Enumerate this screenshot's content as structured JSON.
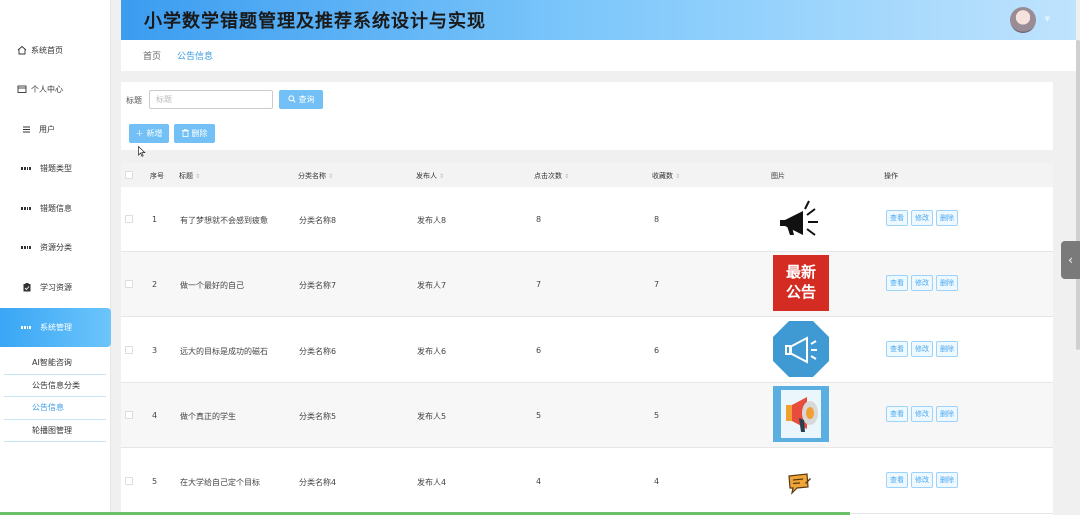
{
  "app": {
    "title": "小学数学错题管理及推荐系统设计与实现"
  },
  "sidebar": {
    "items": [
      {
        "label": "系统首页",
        "icon": "home-icon"
      },
      {
        "label": "个人中心",
        "icon": "card-icon"
      },
      {
        "label": "用户",
        "icon": "list-icon"
      },
      {
        "label": "错题类型",
        "icon": "grid-icon"
      },
      {
        "label": "错题信息",
        "icon": "grid-icon"
      },
      {
        "label": "资源分类",
        "icon": "grid-icon"
      },
      {
        "label": "学习资源",
        "icon": "clipboard-icon"
      },
      {
        "label": "系统管理",
        "icon": "grid-icon",
        "active": true
      }
    ],
    "submenu": [
      {
        "label": "AI智能咨询"
      },
      {
        "label": "公告信息分类"
      },
      {
        "label": "公告信息",
        "active": true
      },
      {
        "label": "轮播图管理"
      }
    ]
  },
  "breadcrumb": {
    "home": "首页",
    "current": "公告信息"
  },
  "search": {
    "label": "标题",
    "placeholder": "标题",
    "button": "查询"
  },
  "toolbar": {
    "add": "新增",
    "delete": "删除"
  },
  "table": {
    "columns": [
      "序号",
      "标题",
      "分类名称",
      "发布人",
      "点击次数",
      "收藏数",
      "图片",
      "操作"
    ],
    "rows": [
      {
        "index": "1",
        "title": "有了梦想就不会感到疲惫",
        "category": "分类名称8",
        "publisher": "发布人8",
        "clicks": "8",
        "favorites": "8",
        "image": "megaphone-icon"
      },
      {
        "index": "2",
        "title": "做一个最好的自己",
        "category": "分类名称7",
        "publisher": "发布人7",
        "clicks": "7",
        "favorites": "7",
        "image": "latest-notice-image",
        "image_text": [
          "最新",
          "公告"
        ]
      },
      {
        "index": "3",
        "title": "远大的目标是成功的磁石",
        "category": "分类名称6",
        "publisher": "发布人6",
        "clicks": "6",
        "favorites": "6",
        "image": "megaphone-octagon-image"
      },
      {
        "index": "4",
        "title": "做个真正的学生",
        "category": "分类名称5",
        "publisher": "发布人5",
        "clicks": "5",
        "favorites": "5",
        "image": "loudspeaker-image"
      },
      {
        "index": "5",
        "title": "在大学给自己定个目标",
        "category": "分类名称4",
        "publisher": "发布人4",
        "clicks": "4",
        "favorites": "4",
        "image": "message-icon"
      }
    ],
    "actions": {
      "view": "查看",
      "edit": "修改",
      "delete": "删除"
    }
  },
  "colors": {
    "accent": "#3a9be0",
    "button": "#73c0f7",
    "header_start": "#3b9cf0",
    "header_end": "#bfe3fd"
  }
}
